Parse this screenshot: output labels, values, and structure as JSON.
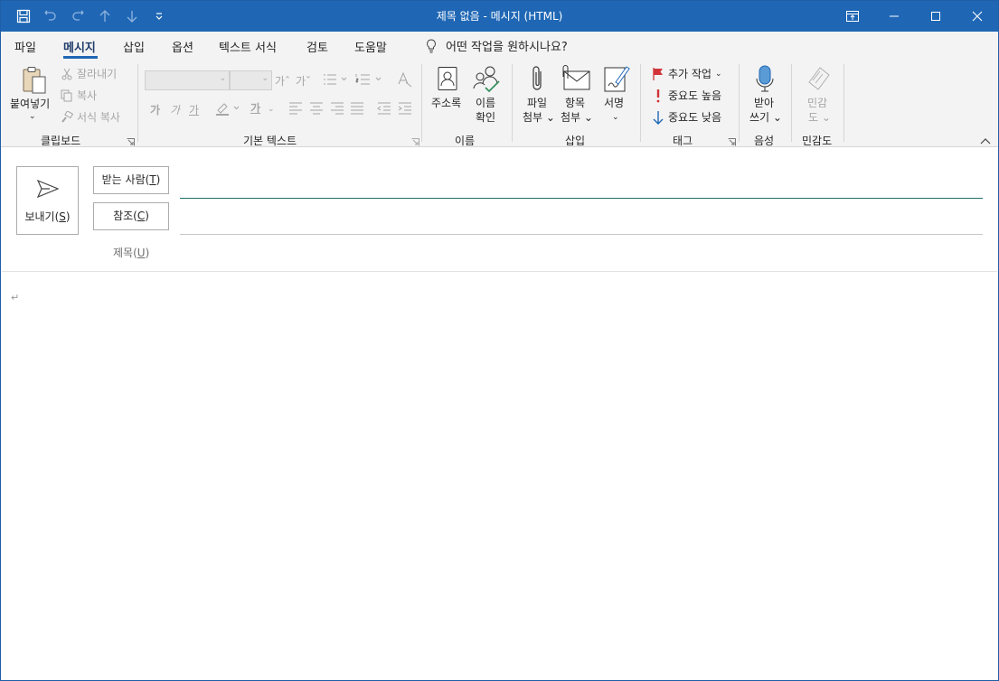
{
  "window": {
    "title": "제목 없음  -  메시지 (HTML)"
  },
  "qat": {
    "items": [
      "save-icon",
      "undo-icon",
      "redo-icon",
      "up-arrow-icon",
      "down-arrow-icon",
      "customize-icon"
    ]
  },
  "tabs": {
    "file": "파일",
    "message": "메시지",
    "insert": "삽입",
    "options": "옵션",
    "format_text": "텍스트 서식",
    "review": "검토",
    "help": "도움말",
    "tell_me": "어떤 작업을 원하시나요?"
  },
  "ribbon": {
    "clipboard": {
      "label": "클립보드",
      "paste": "붙여넣기",
      "cut": "잘라내기",
      "copy": "복사",
      "format_painter": "서식 복사"
    },
    "basic_text": {
      "label": "기본 텍스트",
      "grow_font": "가ˆ",
      "shrink_font": "가ˇ",
      "bold": "가",
      "italic": "가",
      "underline": "가",
      "font_color": "가"
    },
    "names": {
      "label": "이름",
      "address_book": "주소록",
      "check_names_1": "이름",
      "check_names_2": "확인"
    },
    "include": {
      "label": "삽입",
      "attach_file_1": "파일",
      "attach_file_2": "첨부",
      "attach_item_1": "항목",
      "attach_item_2": "첨부",
      "signature": "서명"
    },
    "tags": {
      "label": "태그",
      "follow_up": "추가 작업",
      "high_importance": "중요도 높음",
      "low_importance": "중요도 낮음"
    },
    "voice": {
      "label": "음성",
      "dictate_1": "받아",
      "dictate_2": "쓰기"
    },
    "sensitivity": {
      "label": "민감도",
      "sensitivity_1": "민감",
      "sensitivity_2": "도"
    }
  },
  "compose": {
    "send": "보내기",
    "send_key": "S",
    "to": "받는 사람",
    "to_key": "T",
    "cc": "참조",
    "cc_key": "C",
    "subject": "제목",
    "subject_key": "U",
    "paragraph_mark": "↵"
  },
  "colors": {
    "titlebar": "#1f67b5",
    "ribbon_bg": "#f3f3f3",
    "focus_line": "#1e6f6f",
    "flag_red": "#d13438",
    "accent_blue": "#1f67b5"
  }
}
